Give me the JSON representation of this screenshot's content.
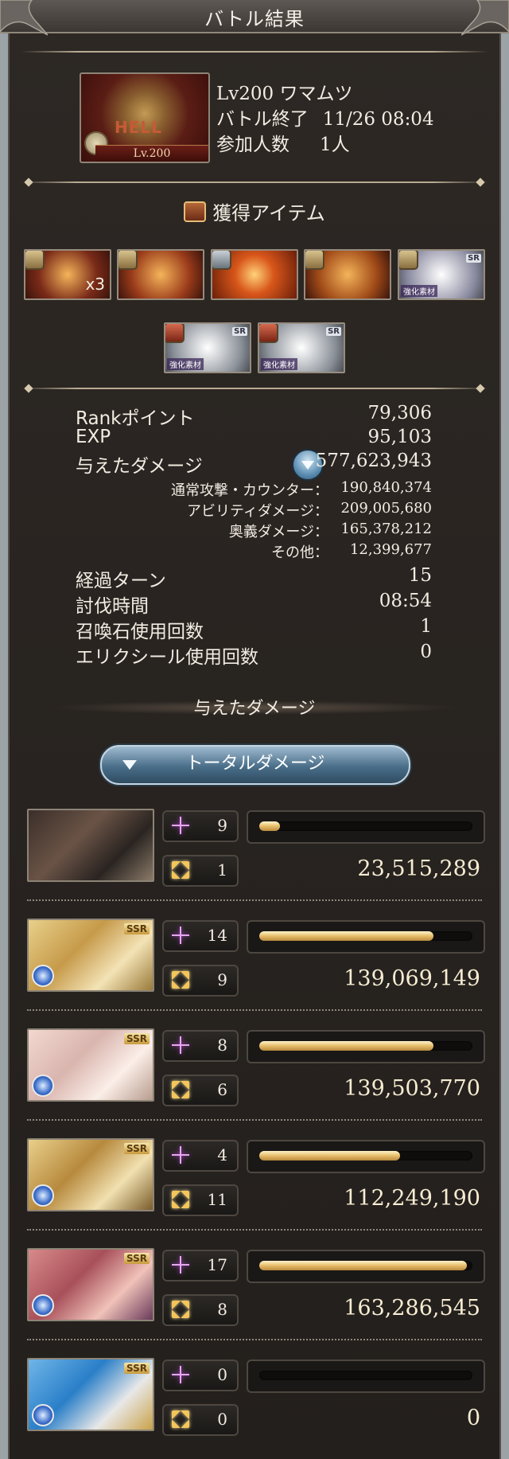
{
  "header": {
    "title": "バトル結果"
  },
  "boss": {
    "thumb_hell": "HELL",
    "thumb_level": "Lv.200",
    "name_line": "Lv200 ワマムツ",
    "end_label": "バトル終了",
    "end_time": "11/26 08:04",
    "participants_label": "参加人数",
    "participants_value": "1人"
  },
  "items": {
    "title": "獲得アイテム",
    "row1": [
      {
        "name": "gold-medal-icon",
        "qty": "x3",
        "tag": "gold",
        "bg": "#7a2a18"
      },
      {
        "name": "red-book-icon",
        "qty": "",
        "tag": "gold",
        "bg": "#9a3b1a"
      },
      {
        "name": "fire-orb-icon",
        "qty": "",
        "tag": "silver",
        "bg": "#8f2f12"
      },
      {
        "name": "fire-emblem-icon",
        "qty": "",
        "tag": "gold",
        "bg": "#a04a18"
      },
      {
        "name": "character-material-icon",
        "qty": "",
        "tag": "gold",
        "bg": "#8a8aa0",
        "mat": "強化素材",
        "ssr": "SR"
      }
    ],
    "row2": [
      {
        "name": "axe-weapon-icon",
        "tag": "red",
        "bg": "#8a9098",
        "mat": "強化素材",
        "ssr": "SR"
      },
      {
        "name": "spear-weapon-icon",
        "tag": "red",
        "bg": "#8a9098",
        "mat": "強化素材",
        "ssr": "SR"
      }
    ]
  },
  "stats": {
    "rank_label": "Rankポイント",
    "rank_value": "79,306",
    "exp_label": "EXP",
    "exp_value": "95,103",
    "damage_label": "与えたダメージ",
    "damage_value": "577,623,943",
    "normal_label": "通常攻撃・カウンター：",
    "normal_value": "190,840,374",
    "ability_label": "アビリティダメージ：",
    "ability_value": "209,005,680",
    "ougi_label": "奥義ダメージ：",
    "ougi_value": "165,378,212",
    "other_label": "その他：",
    "other_value": "12,399,677",
    "turns_label": "経過ターン",
    "turns_value": "15",
    "time_label": "討伐時間",
    "time_value": "08:54",
    "summon_label": "召喚石使用回数",
    "summon_value": "1",
    "elixir_label": "エリクシール使用回数",
    "elixir_value": "0"
  },
  "damage_section": {
    "title": "与えたダメージ",
    "toggle_label": "トータルダメージ"
  },
  "characters": [
    {
      "c1": "9",
      "c2": "1",
      "fill": 0.1,
      "total": "23,515,289",
      "ssr": "",
      "elem": false,
      "bg": "linear-gradient(135deg,#3b2f2a,#6a5346 40%,#2a2421 70%,#8a7a68)"
    },
    {
      "c1": "14",
      "c2": "9",
      "fill": 0.83,
      "total": "139,069,149",
      "ssr": "SSR",
      "elem": true,
      "bg": "linear-gradient(135deg,#e8d08a,#c69a4a 40%,#f3e3b6 70%,#9a7a3a)"
    },
    {
      "c1": "8",
      "c2": "6",
      "fill": 0.83,
      "total": "139,503,770",
      "ssr": "SSR",
      "elem": true,
      "bg": "linear-gradient(135deg,#f2d8d0,#d9b5ae 40%,#fbeee8 70%,#b79c8e)"
    },
    {
      "c1": "4",
      "c2": "11",
      "fill": 0.67,
      "total": "112,249,190",
      "ssr": "SSR",
      "elem": true,
      "bg": "linear-gradient(135deg,#e9cf8a,#b78a3e 40%,#f1e0b0 70%,#7a5c2a)"
    },
    {
      "c1": "17",
      "c2": "8",
      "fill": 0.99,
      "total": "163,286,545",
      "ssr": "SSR",
      "elem": true,
      "bg": "linear-gradient(135deg,#d88a8a,#a8505a 40%,#f0c2b8 70%,#6a3a5a)"
    },
    {
      "c1": "0",
      "c2": "0",
      "fill": 0.0,
      "total": "0",
      "ssr": "SSR",
      "elem": true,
      "bg": "linear-gradient(135deg,#6fb5e8,#2a7fc8 40%,#e8e8e8 70%,#c9a24a)"
    }
  ]
}
